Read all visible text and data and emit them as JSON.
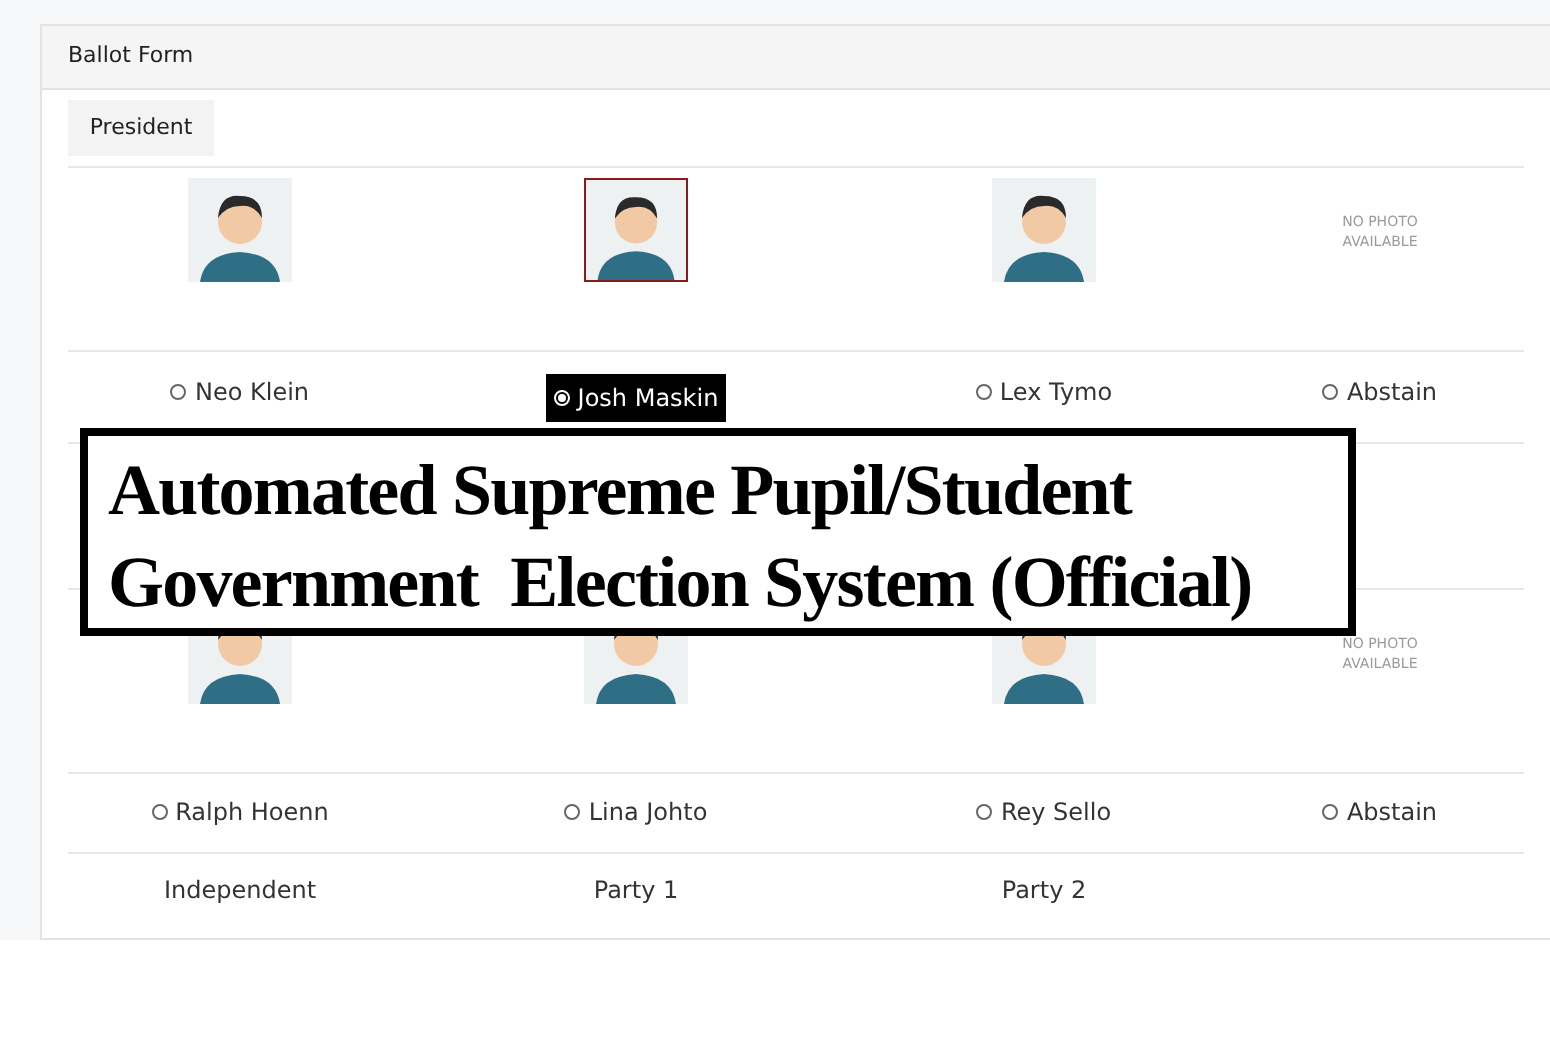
{
  "panel": {
    "title": "Ballot Form"
  },
  "banner": {
    "lines": [
      "Automated Supreme Pupil/Student",
      "Government  Election System (Official)"
    ]
  },
  "positions": [
    {
      "tab": "President",
      "candidates": [
        {
          "kind": "candidate",
          "name": "Neo Klein",
          "selected": false
        },
        {
          "kind": "candidate",
          "name": "Josh Maskin",
          "selected": true
        },
        {
          "kind": "candidate",
          "name": "Lex Tymo",
          "selected": false
        },
        {
          "kind": "abstain",
          "name": "Abstain",
          "photo_text": "NO PHOTO AVAILABLE",
          "selected": false
        }
      ]
    },
    {
      "candidates": [
        {
          "kind": "candidate",
          "name": "Ralph Hoenn",
          "party": "Independent",
          "selected": false
        },
        {
          "kind": "candidate",
          "name": "Lina Johto",
          "party": "Party 1",
          "selected": false
        },
        {
          "kind": "candidate",
          "name": "Rey Sello",
          "party": "Party 2",
          "selected": false
        },
        {
          "kind": "abstain",
          "name": "Abstain",
          "photo_text": "NO PHOTO AVAILABLE",
          "selected": false
        }
      ]
    }
  ]
}
